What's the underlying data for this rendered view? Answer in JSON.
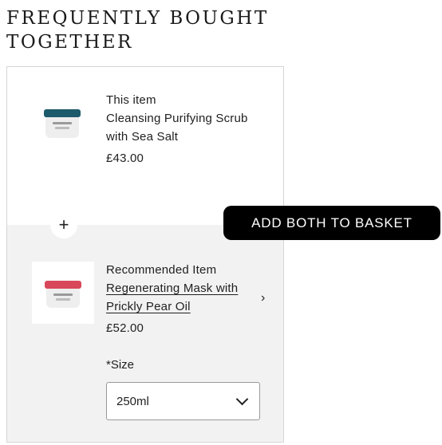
{
  "section": {
    "title": "FREQUENTLY BOUGHT TOGETHER"
  },
  "current_item": {
    "tag": "This item",
    "name_line1": "Cleansing Purifying Scrub",
    "name_line2": "with Sea Salt",
    "price": "£43.00",
    "image": "teal-lid-jar"
  },
  "recommended_item": {
    "tag": "Recommended Item",
    "name_line1": "Regenerating Mask with",
    "name_line2": "Prickly Pear Oil",
    "price": "£52.00",
    "image": "red-lid-jar"
  },
  "size": {
    "label": "*Size",
    "selected": "250ml"
  },
  "actions": {
    "add_both_label": "ADD BOTH TO BASKET"
  },
  "icons": {
    "plus": "+",
    "chevron_right": "›"
  },
  "colors": {
    "button_bg": "#000000",
    "panel_bg": "#f2f2f2",
    "teal_lid": "#1d5a6b",
    "red_lid": "#d9485a"
  }
}
